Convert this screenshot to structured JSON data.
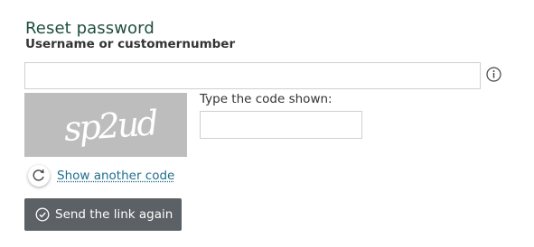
{
  "form": {
    "title": "Reset password",
    "username_label": "Username or customernumber",
    "username_value": "",
    "code_label": "Type the code shown:",
    "code_value": "",
    "captcha_text": "sp2ud",
    "show_another_code_label": "Show another code",
    "send_button_label": "Send the link again"
  },
  "icons": {
    "info": "info-circle-icon",
    "refresh": "refresh-icon",
    "submit": "check-circle-icon"
  },
  "colors": {
    "title": "#1f4e3d",
    "link": "#1f6e8c",
    "button_bg": "#5b6165",
    "captcha_bg": "#bdbdbd"
  }
}
